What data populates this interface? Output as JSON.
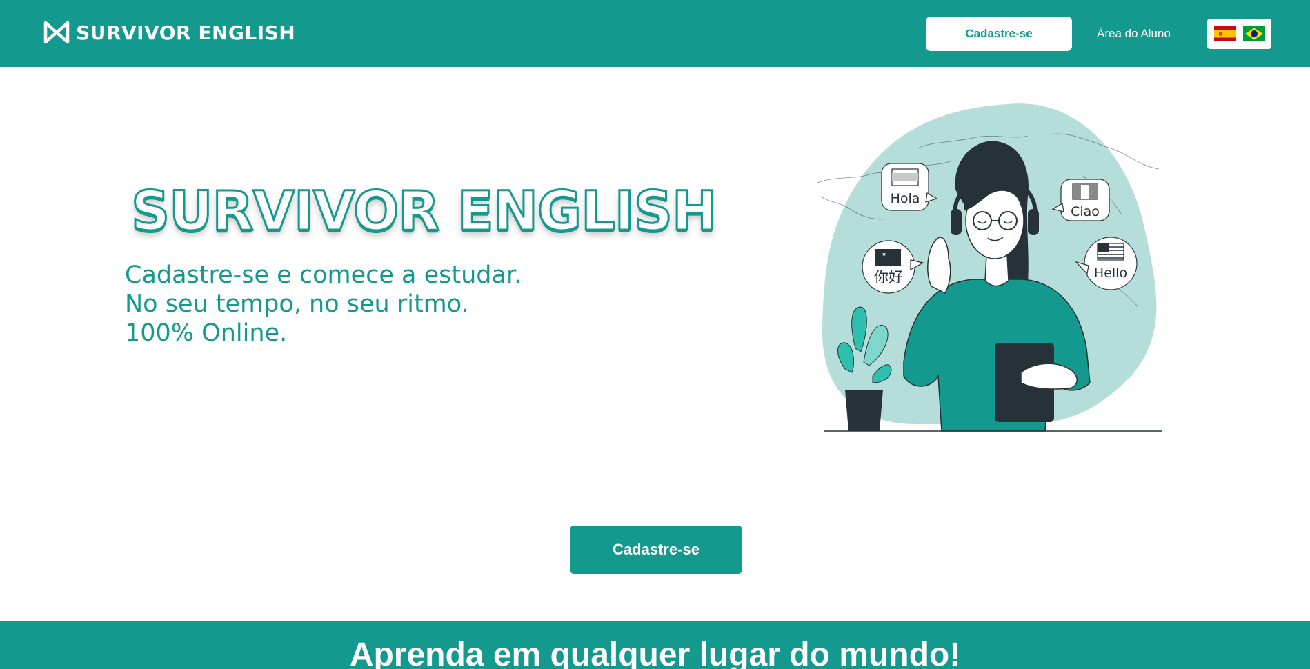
{
  "header": {
    "logo_text": "SURVIVOR ENGLISH",
    "signup_label": "Cadastre-se",
    "student_area_label": "Área do Aluno",
    "languages": [
      {
        "name": "spain-flag-icon",
        "lang": "es"
      },
      {
        "name": "brazil-flag-icon",
        "lang": "pt"
      }
    ]
  },
  "hero": {
    "title": "SURVIVOR ENGLISH",
    "lines": [
      "Cadastre-se e comece a estudar.",
      "No seu tempo, no seu ritmo.",
      "100% Online."
    ],
    "bubbles": {
      "hola": "Hola",
      "ciao": "Ciao",
      "nihao": "你好",
      "hello": "Hello"
    }
  },
  "cta": {
    "signup_label": "Cadastre-se"
  },
  "band": {
    "title": "Aprenda em qualquer lugar do mundo!"
  },
  "colors": {
    "brand": "#13998e",
    "blob": "#b5dedb",
    "dark": "#263238",
    "white": "#ffffff"
  }
}
